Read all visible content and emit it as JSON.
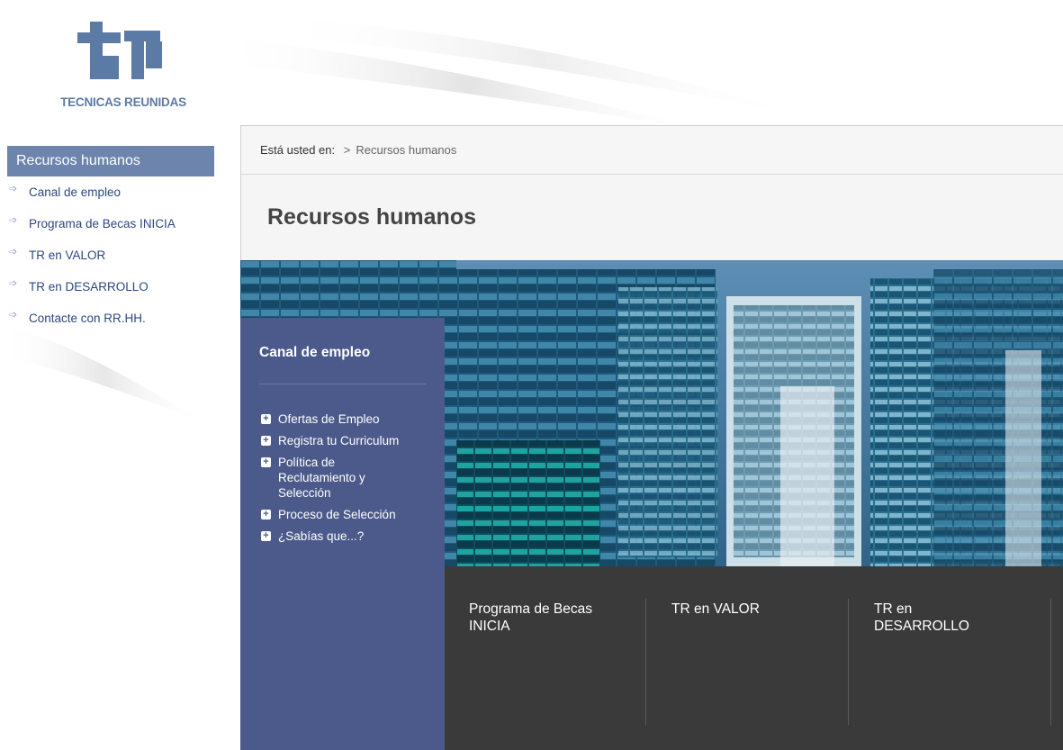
{
  "brand": {
    "name": "TECNICAS REUNIDAS",
    "logo_color": "#5c7aa6"
  },
  "leftnav": {
    "title": "Recursos humanos",
    "items": [
      {
        "label": "Canal de empleo"
      },
      {
        "label": "Programa de Becas INICIA"
      },
      {
        "label": "TR en VALOR"
      },
      {
        "label": "TR en DESARROLLO"
      },
      {
        "label": "Contacte con RR.HH."
      }
    ]
  },
  "breadcrumb": {
    "prefix": "Está usted en:",
    "separator": ">",
    "current": "Recursos humanos"
  },
  "page": {
    "title": "Recursos humanos"
  },
  "empleo_panel": {
    "title": "Canal de empleo",
    "items": [
      {
        "label": "Ofertas de Empleo"
      },
      {
        "label": "Registra tu Curriculum"
      },
      {
        "label": "Política de Reclutamiento y Selección"
      },
      {
        "label": "Proceso de Selección"
      },
      {
        "label": "¿Sabías que...?"
      }
    ]
  },
  "tiles": [
    {
      "label": "Programa de Becas INICIA"
    },
    {
      "label": "TR en VALOR"
    },
    {
      "label": "TR en DESARROLLO"
    }
  ],
  "colors": {
    "nav_title_bg": "#6d84ad",
    "panel_bg": "#4b5a8a",
    "tiles_bg": "#3a3a3a",
    "link": "#2b4880"
  }
}
